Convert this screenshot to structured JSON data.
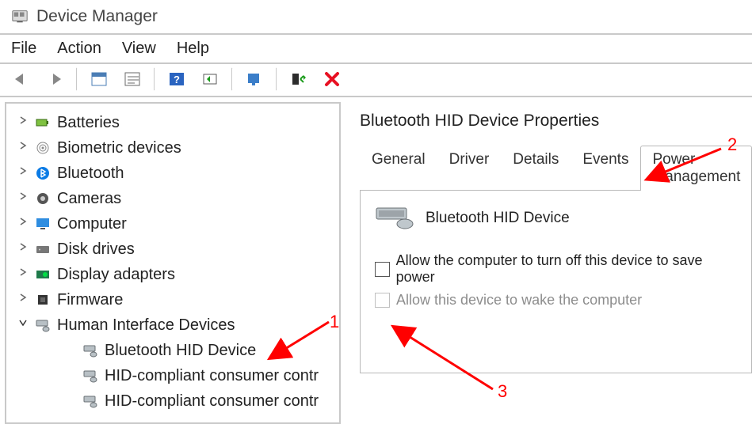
{
  "window": {
    "title": "Device Manager"
  },
  "menu": {
    "file": "File",
    "action": "Action",
    "view": "View",
    "help": "Help"
  },
  "tree": {
    "items": [
      {
        "label": "Batteries",
        "icon": "battery-icon"
      },
      {
        "label": "Biometric devices",
        "icon": "fingerprint-icon"
      },
      {
        "label": "Bluetooth",
        "icon": "bluetooth-icon"
      },
      {
        "label": "Cameras",
        "icon": "camera-icon"
      },
      {
        "label": "Computer",
        "icon": "monitor-icon"
      },
      {
        "label": "Disk drives",
        "icon": "hdd-icon"
      },
      {
        "label": "Display adapters",
        "icon": "gpu-icon"
      },
      {
        "label": "Firmware",
        "icon": "chip-icon"
      }
    ],
    "hid": {
      "label": "Human Interface Devices",
      "children": [
        {
          "label": "Bluetooth HID Device"
        },
        {
          "label": "HID-compliant consumer contr"
        },
        {
          "label": "HID-compliant consumer contr"
        }
      ]
    }
  },
  "props": {
    "title": "Bluetooth HID Device Properties",
    "tabs": {
      "general": "General",
      "driver": "Driver",
      "details": "Details",
      "events": "Events",
      "power": "Power Management"
    },
    "device_name": "Bluetooth HID Device",
    "check1": "Allow the computer to turn off this device to save power",
    "check2": "Allow this device to wake the computer"
  },
  "anno": {
    "n1": "1",
    "n2": "2",
    "n3": "3"
  }
}
